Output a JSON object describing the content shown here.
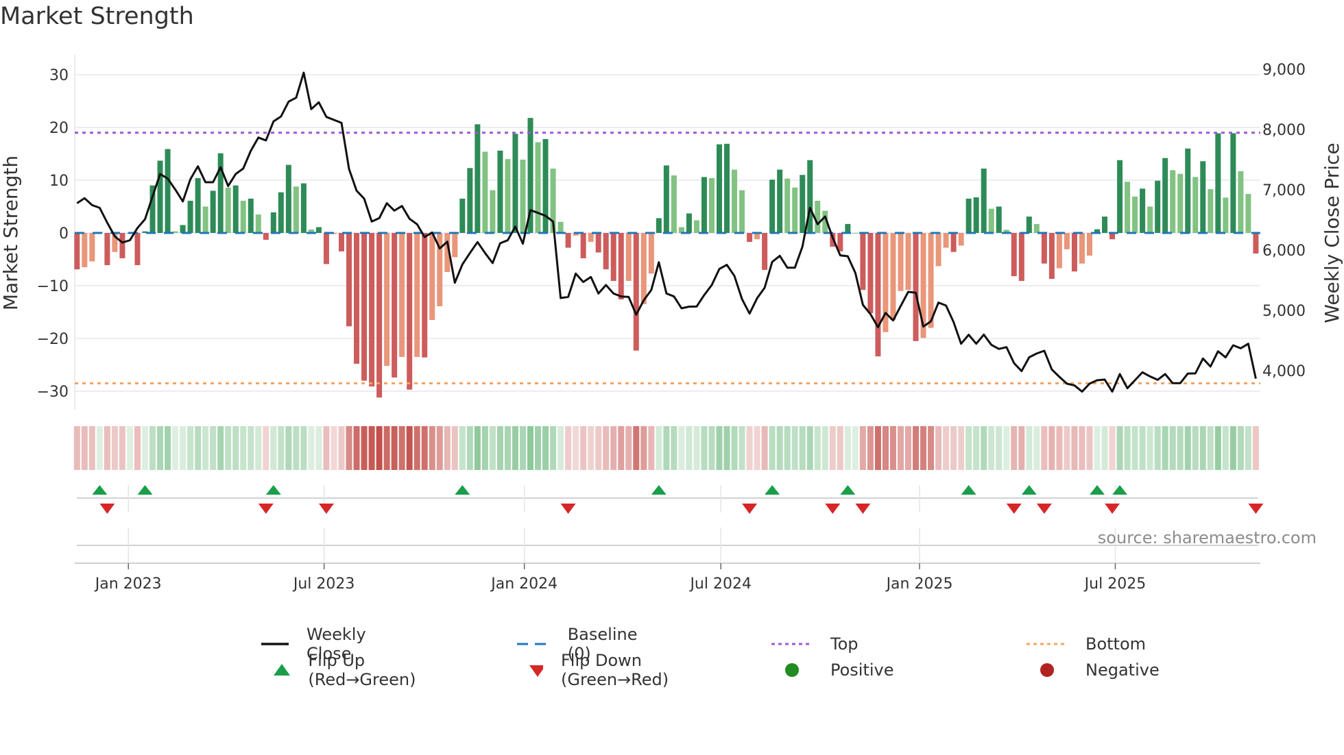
{
  "title": "Market Strength",
  "source": "source: sharemaestro.com",
  "legend": {
    "weekly_close": "Weekly Close",
    "baseline": "Baseline (0)",
    "top": "Top",
    "bottom": "Bottom",
    "flip_up": "Flip Up (Red→Green)",
    "flip_down": "Flip Down (Green→Red)",
    "positive": "Positive",
    "negative": "Negative"
  },
  "colors": {
    "pos_strong": "#2e8b57",
    "pos_weak": "#82c282",
    "neg_strong": "#cd5c5c",
    "neg_weak": "#e9967a",
    "baseline": "#1f77b4",
    "top": "#9b59d6",
    "bottom": "#f4a460",
    "flip_up": "#1a9e4a",
    "flip_down": "#d62728",
    "positive": "#228b22",
    "negative": "#b22222",
    "close": "#111111"
  },
  "chart_data": {
    "type": "bar",
    "title": "Market Strength",
    "ylabel": "Market Strength",
    "y2label": "Weekly Close Price",
    "left_ticks": [
      "30",
      "20",
      "10",
      "0",
      "−10",
      "−20",
      "−30"
    ],
    "left_tick_values": [
      30,
      20,
      10,
      0,
      -10,
      -20,
      -30
    ],
    "right_ticks": [
      "9,000",
      "8,000",
      "7,000",
      "6,000",
      "5,000",
      "4,000"
    ],
    "right_tick_values": [
      9000,
      8000,
      7000,
      6000,
      5000,
      4000
    ],
    "x_ticks": [
      "Jan 2023",
      "Jul 2023",
      "Jan 2024",
      "Jul 2024",
      "Jan 2025",
      "Jul 2025"
    ],
    "baseline": 0,
    "top": 19,
    "bottom": -28.5,
    "grid": true,
    "legend_position": "bottom",
    "strength": [
      -6.9,
      -6.5,
      -5.4,
      0.2,
      -6.1,
      -3.6,
      -4.8,
      0,
      -6.1,
      0.3,
      9.0,
      13.7,
      15.9,
      0.3,
      1.5,
      6.1,
      10.4,
      5.0,
      8.0,
      15.1,
      8.6,
      9.0,
      6.1,
      6.5,
      3.5,
      -1.3,
      3.9,
      7.7,
      12.9,
      8.8,
      9.4,
      0.65,
      1.1,
      -5.9,
      -0.2,
      -3.5,
      -17.7,
      -24.8,
      -28,
      -29.1,
      -31.2,
      -25.2,
      -27.4,
      -23.5,
      -29.7,
      -23.5,
      -23.6,
      -16.5,
      -13.9,
      -7.4,
      -4.6,
      6.5,
      12.3,
      20.6,
      15.4,
      8.1,
      15.6,
      14.0,
      18.8,
      13.9,
      21.8,
      17.2,
      17.8,
      12.2,
      2.1,
      -2.8,
      -0.5,
      -4.8,
      -1.7,
      -3.7,
      -6.9,
      -9.1,
      -12.6,
      -9.1,
      -22.3,
      -13.5,
      -7.7,
      2.8,
      12.8,
      10.9,
      1.1,
      3.7,
      2.4,
      10.6,
      10.4,
      16.8,
      16.9,
      12.0,
      8.1,
      -1.7,
      -1.2,
      -7.0,
      10.1,
      12.0,
      10.3,
      8.6,
      11.0,
      13.8,
      6.1,
      4.2,
      -2.6,
      -3.5,
      1.7,
      0,
      -10.8,
      -15.2,
      -23.4,
      -18.8,
      -16.5,
      -11.0,
      -10.8,
      -20.5,
      -19.9,
      -18.0,
      -6.3,
      -2.8,
      -3.6,
      -2.4,
      6.5,
      6.75,
      12.2,
      4.6,
      5.0,
      0.6,
      -8.2,
      -9.1,
      3.1,
      1.7,
      -5.8,
      -8.7,
      -6.7,
      -3.1,
      -7.3,
      -5.8,
      -4.3,
      0.7,
      3.1,
      -1.2,
      13.8,
      9.7,
      6.9,
      8.4,
      5.0,
      9.9,
      14.2,
      11.9,
      11.2,
      16.0,
      10.6,
      13.6,
      8.3,
      18.9,
      6.7,
      18.9,
      11.7,
      7.4,
      -3.9
    ],
    "close": [
      6777,
      6860,
      6746,
      6700,
      6455,
      6227,
      6125,
      6163,
      6367,
      6511,
      6890,
      7261,
      7186,
      7004,
      6807,
      7174,
      7390,
      7125,
      7125,
      7375,
      7061,
      7261,
      7352,
      7648,
      7867,
      7818,
      8133,
      8216,
      8462,
      8527,
      8943,
      8337,
      8451,
      8208,
      8159,
      8110,
      7345,
      6985,
      6852,
      6473,
      6530,
      6777,
      6655,
      6731,
      6519,
      6428,
      6216,
      6292,
      6027,
      6140,
      5458,
      5761,
      5951,
      6133,
      5951,
      5784,
      6114,
      6163,
      6390,
      6106,
      6663,
      6617,
      6568,
      6473,
      5205,
      5223,
      5610,
      5470,
      5553,
      5280,
      5420,
      5280,
      5231,
      5223,
      4928,
      5167,
      5337,
      5799,
      5280,
      5231,
      5034,
      5061,
      5064,
      5254,
      5420,
      5686,
      5754,
      5572,
      5186,
      4947,
      5201,
      5375,
      5803,
      5905,
      5708,
      5708,
      6057,
      6701,
      6428,
      6557,
      6208,
      5913,
      5898,
      5621,
      5091,
      4939,
      4720,
      4958,
      4833,
      5072,
      5307,
      5292,
      4731,
      4818,
      5129,
      5080,
      4807,
      4447,
      4595,
      4447,
      4598,
      4428,
      4360,
      4390,
      4125,
      3992,
      4220,
      4284,
      4330,
      4019,
      3898,
      3784,
      3754,
      3652,
      3784,
      3841,
      3852,
      3652,
      3943,
      3708,
      3841,
      3973,
      3905,
      3848,
      3943,
      3792,
      3792,
      3951,
      3955,
      4201,
      4068,
      4322,
      4220,
      4420,
      4371,
      4447,
      3867
    ]
  }
}
